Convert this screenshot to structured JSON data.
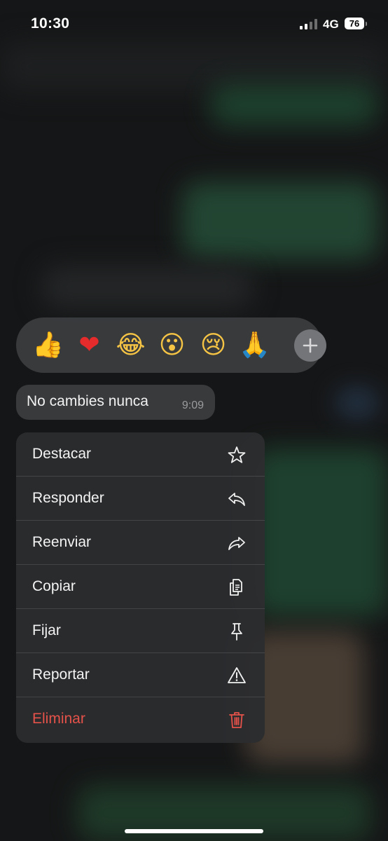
{
  "status_bar": {
    "time": "10:30",
    "network": "4G",
    "battery": "76",
    "signal_bars_lit": 2,
    "signal_bars_total": 4
  },
  "reactions": {
    "items": [
      {
        "emoji": "👍",
        "name": "thumbs-up"
      },
      {
        "emoji": "❤",
        "name": "red-heart"
      },
      {
        "emoji": "😂",
        "name": "tears-of-joy"
      },
      {
        "emoji": "😮",
        "name": "surprised-face"
      },
      {
        "emoji": "😢",
        "name": "crying-face"
      },
      {
        "emoji": "🙏",
        "name": "folded-hands"
      }
    ],
    "more_icon": "plus-icon"
  },
  "message": {
    "text": "No cambies nunca",
    "time": "9:09"
  },
  "menu": {
    "items": [
      {
        "label": "Destacar",
        "icon": "star-icon"
      },
      {
        "label": "Responder",
        "icon": "reply-icon"
      },
      {
        "label": "Reenviar",
        "icon": "forward-icon"
      },
      {
        "label": "Copiar",
        "icon": "copy-icon"
      },
      {
        "label": "Fijar",
        "icon": "pin-icon"
      },
      {
        "label": "Reportar",
        "icon": "warning-icon"
      },
      {
        "label": "Eliminar",
        "icon": "trash-icon",
        "destructive": true
      }
    ],
    "destructive_color": "#e5524a"
  }
}
